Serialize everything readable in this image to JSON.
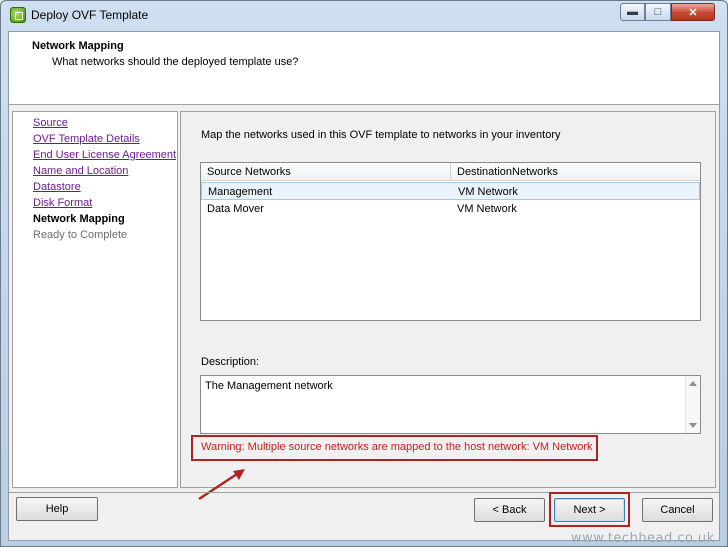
{
  "window": {
    "title": "Deploy OVF Template",
    "controls": [
      "minimize",
      "maximize",
      "close"
    ]
  },
  "header": {
    "title": "Network Mapping",
    "subtitle": "What networks should the deployed template use?"
  },
  "steps": [
    {
      "label": "Source",
      "state": "link"
    },
    {
      "label": "OVF Template Details",
      "state": "link"
    },
    {
      "label": "End User License Agreement",
      "state": "link"
    },
    {
      "label": "Name and Location",
      "state": "link"
    },
    {
      "label": "Datastore",
      "state": "link"
    },
    {
      "label": "Disk Format",
      "state": "link"
    },
    {
      "label": "Network Mapping",
      "state": "current"
    },
    {
      "label": "Ready to Complete",
      "state": "disabled"
    }
  ],
  "main": {
    "instruction": "Map the networks used in this OVF template to networks in your inventory",
    "table": {
      "columns": [
        "Source Networks",
        "DestinationNetworks"
      ],
      "rows": [
        {
          "source": "Management",
          "destination": "VM Network",
          "selected": true
        },
        {
          "source": "Data Mover",
          "destination": "VM Network",
          "selected": false
        }
      ]
    },
    "description_label": "Description:",
    "description_text": "The Management network",
    "warning": "Warning: Multiple source networks are mapped to the host network: VM Network"
  },
  "buttons": {
    "help": "Help",
    "back": "< Back",
    "next": "Next >",
    "cancel": "Cancel"
  },
  "watermark": "www.techhead.co.uk",
  "colors": {
    "highlight_red": "#b02323",
    "warning_text": "#c81f1f",
    "link": "#6a1b9a"
  }
}
